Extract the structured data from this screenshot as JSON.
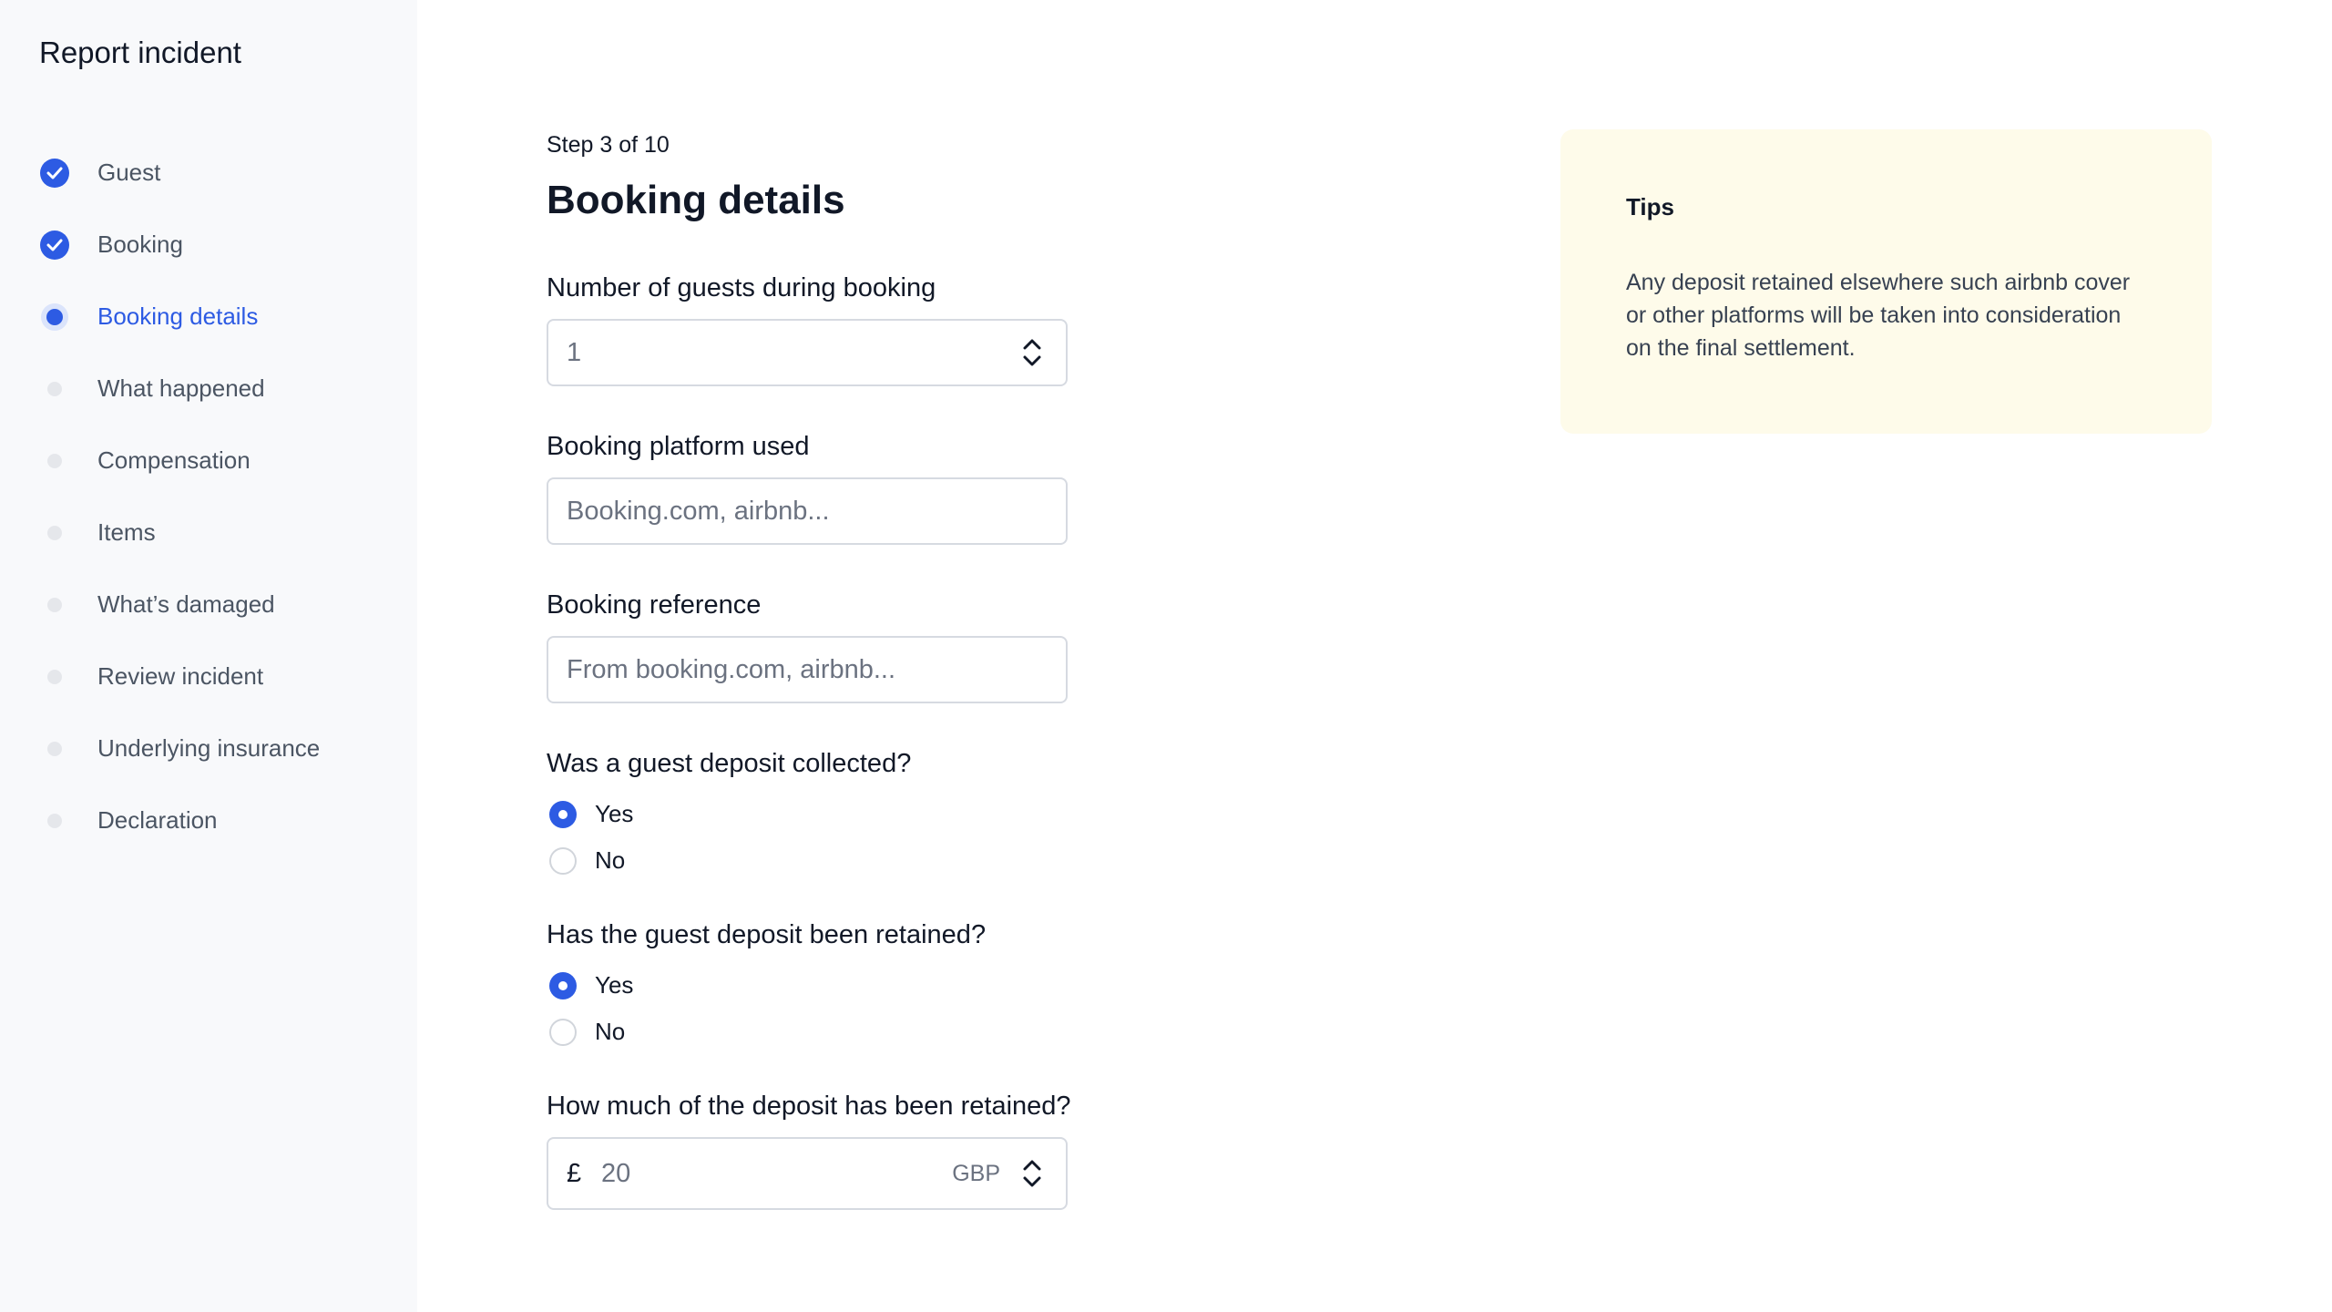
{
  "sidebar": {
    "title": "Report incident",
    "steps": [
      {
        "label": "Guest",
        "state": "done"
      },
      {
        "label": "Booking",
        "state": "done"
      },
      {
        "label": "Booking details",
        "state": "current"
      },
      {
        "label": "What happened",
        "state": "pending"
      },
      {
        "label": "Compensation",
        "state": "pending"
      },
      {
        "label": "Items",
        "state": "pending"
      },
      {
        "label": "What’s damaged",
        "state": "pending"
      },
      {
        "label": "Review incident",
        "state": "pending"
      },
      {
        "label": "Underlying insurance",
        "state": "pending"
      },
      {
        "label": "Declaration",
        "state": "pending"
      }
    ]
  },
  "main": {
    "step_counter": "Step 3 of 10",
    "title": "Booking details",
    "guests": {
      "label": "Number of guests during booking",
      "value": "1"
    },
    "platform": {
      "label": "Booking platform used",
      "placeholder": "Booking.com, airbnb..."
    },
    "reference": {
      "label": "Booking reference",
      "placeholder": "From booking.com, airbnb..."
    },
    "deposit_collected": {
      "label": "Was a guest deposit collected?",
      "options": [
        "Yes",
        "No"
      ],
      "selected": "Yes"
    },
    "deposit_retained": {
      "label": "Has the guest deposit been retained?",
      "options": [
        "Yes",
        "No"
      ],
      "selected": "Yes"
    },
    "retained_amount": {
      "label": "How much of the deposit has been retained?",
      "currency_symbol": "£",
      "value": "20",
      "currency": "GBP"
    }
  },
  "tips": {
    "title": "Tips",
    "body": "Any deposit retained elsewhere such airbnb cover or other platforms will be taken into consideration on the final settlement."
  },
  "colors": {
    "accent": "#2d5be3",
    "sidebar_bg": "#f8f9fb",
    "tips_bg": "#fefbea"
  }
}
